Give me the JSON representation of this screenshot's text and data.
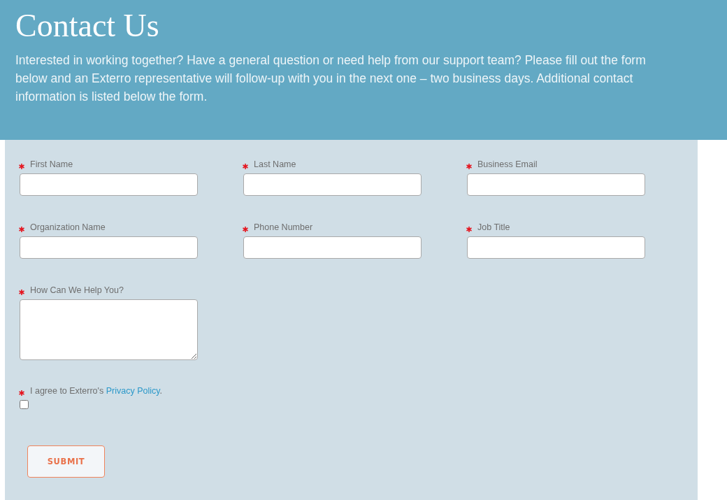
{
  "header": {
    "title": "Contact Us",
    "intro": "Interested in working together? Have a general question or need help from our support team? Please fill out the form below and an Exterro representative will follow-up with you in the next one – two business days. Additional contact information is listed below the form."
  },
  "form": {
    "fields": [
      {
        "label": "First Name",
        "required": true,
        "kind": "text"
      },
      {
        "label": "Last Name",
        "required": true,
        "kind": "text"
      },
      {
        "label": "Business Email",
        "required": true,
        "kind": "text"
      },
      {
        "label": "Organization Name",
        "required": true,
        "kind": "text"
      },
      {
        "label": "Phone Number",
        "required": true,
        "kind": "text"
      },
      {
        "label": "Job Title",
        "required": true,
        "kind": "text"
      },
      {
        "label": "How Can We Help You?",
        "required": true,
        "kind": "textarea"
      }
    ],
    "consent": {
      "required": true,
      "text": "I agree to Exterro's",
      "link": "Privacy Policy",
      "after": ".",
      "checked": false
    },
    "submit": "SUBMIT"
  }
}
